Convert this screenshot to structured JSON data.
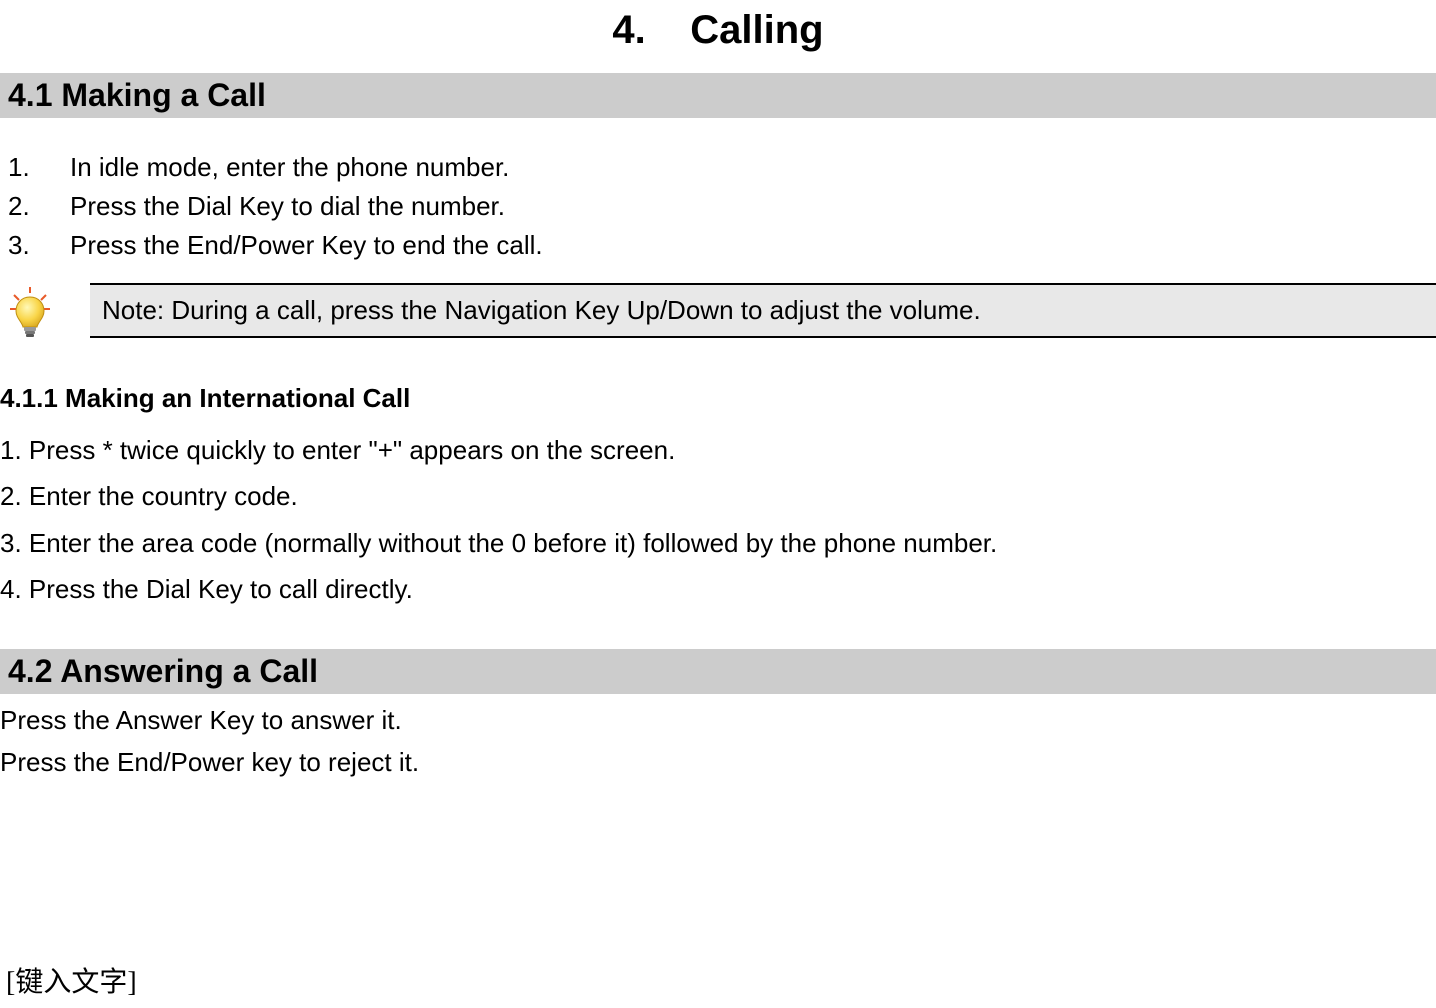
{
  "chapter": {
    "number": "4.",
    "title": "Calling"
  },
  "section_4_1": {
    "heading": "4.1  Making a Call",
    "steps": [
      {
        "num": "1.",
        "text": "In idle mode, enter the phone number."
      },
      {
        "num": "2.",
        "text": "Press the Dial Key to dial the number."
      },
      {
        "num": "3.",
        "text": "Press the End/Power Key to end the call."
      }
    ],
    "note": "Note: During a call, press the Navigation Key Up/Down to adjust the volume."
  },
  "section_4_1_1": {
    "heading": "4.1.1    Making an International Call",
    "steps": [
      "1. Press * twice quickly to enter \"+\" appears on the screen.",
      "2. Enter the country code.",
      "3. Enter the area code (normally without the 0 before it) followed by the phone number.",
      "4. Press the Dial Key to call directly."
    ]
  },
  "section_4_2": {
    "heading": "4.2  Answering a Call",
    "body": [
      "Press the Answer Key to answer it.",
      "Press the End/Power key to reject it."
    ]
  },
  "footer": "[键入文字]"
}
